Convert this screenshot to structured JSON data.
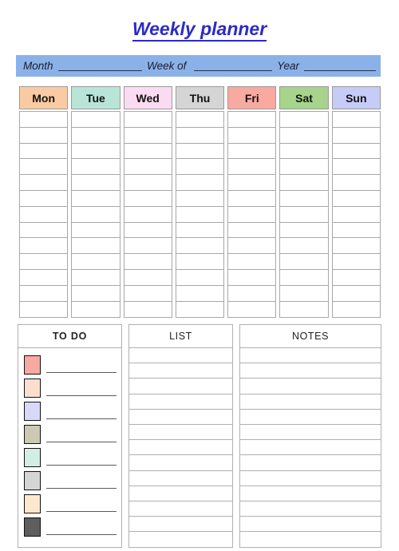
{
  "title": "Weekly planner",
  "header": {
    "month_label": "Month",
    "week_label": "Week of",
    "year_label": "Year"
  },
  "week": {
    "days": [
      {
        "label": "Mon",
        "color": "#FACBA3"
      },
      {
        "label": "Tue",
        "color": "#B8E5D8"
      },
      {
        "label": "Wed",
        "color": "#FBDBF2"
      },
      {
        "label": "Thu",
        "color": "#D5D5D5"
      },
      {
        "label": "Fri",
        "color": "#F8A9A0"
      },
      {
        "label": "Sat",
        "color": "#A5D48A"
      },
      {
        "label": "Sun",
        "color": "#C6CBF7"
      }
    ],
    "rows_per_day": 13
  },
  "todo": {
    "heading": "TO DO",
    "items": [
      {
        "color": "#F8A9A0"
      },
      {
        "color": "#FBDFCE"
      },
      {
        "color": "#D6DAF8"
      },
      {
        "color": "#CCC8B2"
      },
      {
        "color": "#D2EDE4"
      },
      {
        "color": "#D5D5D5"
      },
      {
        "color": "#FDE8CE"
      },
      {
        "color": "#5E5E5E"
      }
    ]
  },
  "list": {
    "heading": "LIST",
    "rows": 13
  },
  "notes": {
    "heading": "NOTES",
    "rows": 13
  },
  "colors": {
    "title": "#2B2BC8",
    "header_bar": "#8BB2E8",
    "border": "#b0b0b0"
  }
}
